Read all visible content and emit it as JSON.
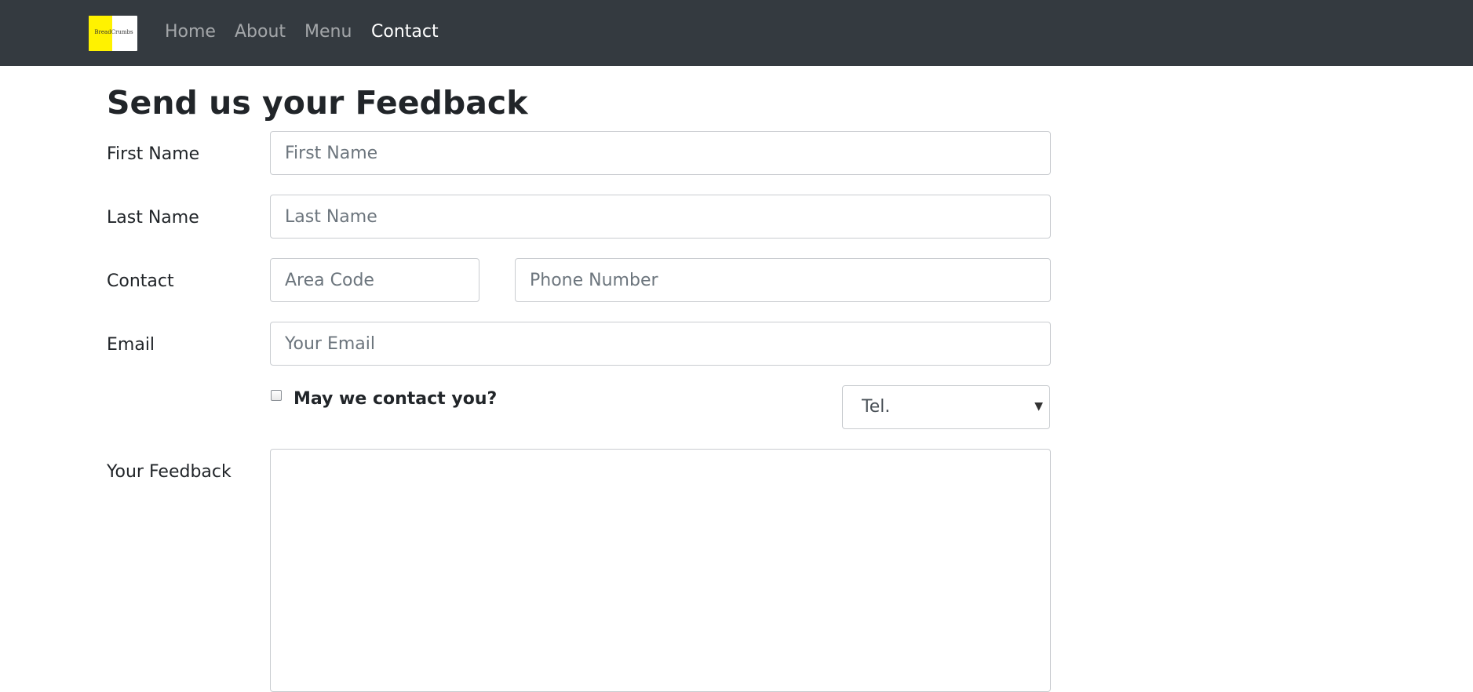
{
  "navbar": {
    "logo_text": "BreadCrumbs",
    "links": [
      "Home",
      "About",
      "Menu",
      "Contact"
    ],
    "active": "Contact"
  },
  "form": {
    "title": "Send us your Feedback",
    "first_name": {
      "label": "First Name",
      "placeholder": "First Name",
      "value": ""
    },
    "last_name": {
      "label": "Last Name",
      "placeholder": "Last Name",
      "value": ""
    },
    "contact": {
      "label": "Contact",
      "area_code_placeholder": "Area Code",
      "phone_placeholder": "Phone Number"
    },
    "email": {
      "label": "Email",
      "placeholder": "Your Email",
      "value": ""
    },
    "contact_permission": {
      "label": "May we contact you?",
      "checked": false
    },
    "contact_method": {
      "selected": "Tel."
    },
    "feedback": {
      "label": "Your Feedback",
      "value": ""
    }
  },
  "colors": {
    "navbar_bg": "#343a40",
    "logo_accent": "#fff200",
    "nav_link": "rgba(255,255,255,0.55)",
    "nav_active": "#ffffff",
    "input_border": "#c9ccd0"
  }
}
